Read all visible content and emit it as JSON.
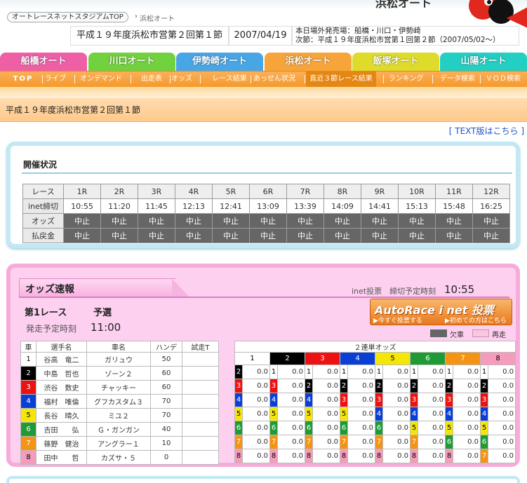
{
  "header": {
    "breadcrumb_home": "オートレースネットスタジアムTOP",
    "breadcrumb_arrow": "›",
    "breadcrumb_current": "浜松オート",
    "logo_text": "浜松オート",
    "meet_name": "平成１９年度浜松市営第２回第１節",
    "meet_date": "2007/04/19",
    "today_sales": "本日場外発売場：船橋・川口・伊勢崎",
    "next_meet": "次節：平成１９年度浜松市営第１回第２節（2007/05/02～）"
  },
  "venues": [
    {
      "label": "船橋オート",
      "color": "#ef5fa6"
    },
    {
      "label": "川口オート",
      "color": "#72d13e"
    },
    {
      "label": "伊勢崎オート",
      "color": "#49a6e6"
    },
    {
      "label": "浜松オート",
      "color": "#f7a53a"
    },
    {
      "label": "飯塚オート",
      "color": "#dedb2b"
    },
    {
      "label": "山陽オート",
      "color": "#22cfc2"
    }
  ],
  "subnav": [
    "TOP",
    "ライブ",
    "オンデマンド",
    "出走表",
    "オッズ",
    "レース結果",
    "あっせん状況",
    "直近３節レース結果",
    "ランキング",
    "データ検索",
    "ＶＯＤ検索"
  ],
  "page_title": "平成１９年度浜松市営第２回第１節",
  "text_link": "TEXT版はこちら",
  "status": {
    "title": "開催状況",
    "row_labels": [
      "レース",
      "inet締切",
      "オッズ",
      "払戻金"
    ],
    "races": [
      "1R",
      "2R",
      "3R",
      "4R",
      "5R",
      "6R",
      "7R",
      "8R",
      "9R",
      "10R",
      "11R",
      "12R"
    ],
    "deadlines": [
      "10:55",
      "11:20",
      "11:45",
      "12:13",
      "12:41",
      "13:09",
      "13:39",
      "14:09",
      "14:41",
      "15:13",
      "15:48",
      "16:25"
    ],
    "cancel_label": "中止"
  },
  "odds": {
    "title": "オッズ速報",
    "inet_label": "inet投票　締切予定時刻",
    "inet_time": "10:55",
    "race_name": "第1レース",
    "race_type": "予選",
    "start_label": "発走予定時刻",
    "start_time": "11:00",
    "banner_title": "AutoRace i net 投票",
    "banner_left": "▶今すぐ投票する",
    "banner_right": "▶初めての方はこちら",
    "legend_cancel": "欠車",
    "legend_rerun": "再走",
    "rider_headers": [
      "車",
      "選手名",
      "車名",
      "ハンデ",
      "試走T"
    ],
    "quinella_header": "２連単オッズ",
    "odds_value": "0.0",
    "colors": [
      "#ffffff",
      "#000000",
      "#ee1111",
      "#0a3fd6",
      "#f4e608",
      "#1f9b36",
      "#f59414",
      "#f59bbb"
    ],
    "num_text": [
      "#000000",
      "#ffffff",
      "#ffffff",
      "#ffffff",
      "#000000",
      "#ffffff",
      "#ffffff",
      "#000000"
    ],
    "riders": [
      {
        "no": "1",
        "name": "谷高　竜二",
        "bike": "ガリュウ",
        "handi": "50",
        "trial": ""
      },
      {
        "no": "2",
        "name": "中島　哲也",
        "bike": "ゾーン２",
        "handi": "60",
        "trial": ""
      },
      {
        "no": "3",
        "name": "渋谷　数史",
        "bike": "チャッキー",
        "handi": "60",
        "trial": ""
      },
      {
        "no": "4",
        "name": "福村　唯倫",
        "bike": "グフカスタム３",
        "handi": "70",
        "trial": ""
      },
      {
        "no": "5",
        "name": "長谷　晴久",
        "bike": "ミユ２",
        "handi": "70",
        "trial": ""
      },
      {
        "no": "6",
        "name": "吉田　　弘",
        "bike": "Ｇ・ガンガン",
        "handi": "40",
        "trial": ""
      },
      {
        "no": "7",
        "name": "篠野　健治",
        "bike": "アングラー１",
        "handi": "10",
        "trial": ""
      },
      {
        "no": "8",
        "name": "田中　　哲",
        "bike": "カズサ・５",
        "handi": "0",
        "trial": ""
      }
    ],
    "quinella_rows": [
      [
        "2",
        "3",
        "4",
        "5",
        "6",
        "7",
        "8"
      ],
      [
        "1",
        "3",
        "4",
        "5",
        "6",
        "7",
        "8"
      ],
      [
        "1",
        "2",
        "4",
        "5",
        "6",
        "7",
        "8"
      ],
      [
        "1",
        "2",
        "3",
        "5",
        "6",
        "7",
        "8"
      ],
      [
        "1",
        "2",
        "3",
        "4",
        "6",
        "7",
        "8"
      ],
      [
        "1",
        "2",
        "3",
        "4",
        "5",
        "7",
        "8"
      ],
      [
        "1",
        "2",
        "3",
        "4",
        "5",
        "6",
        "8"
      ]
    ]
  }
}
